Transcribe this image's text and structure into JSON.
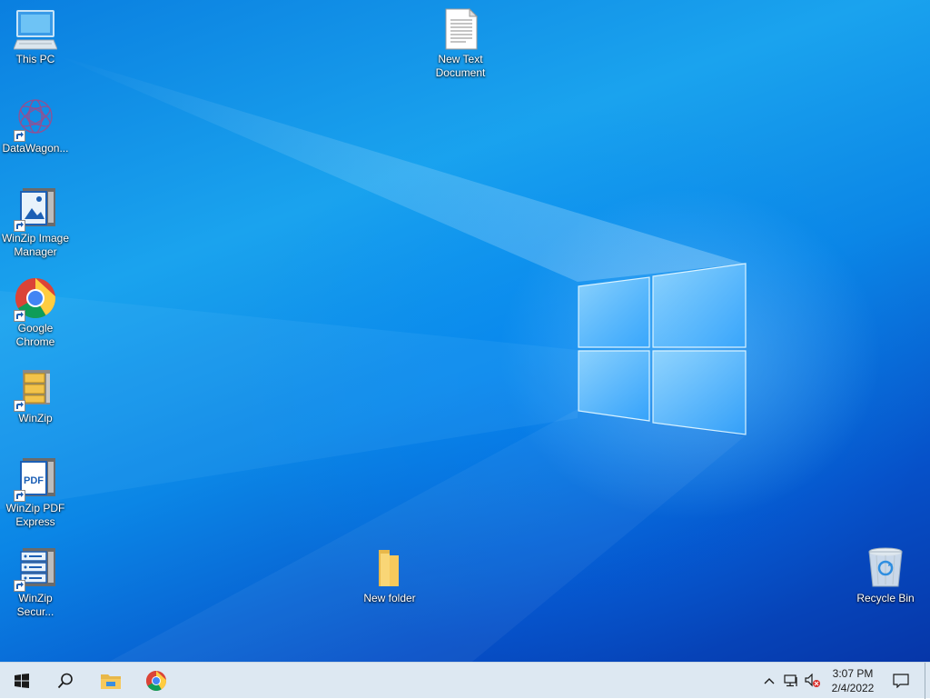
{
  "desktop": {
    "icons": {
      "this_pc": "This PC",
      "datawagon": "DataWagon...",
      "winzip_image_manager": "WinZip Image\nManager",
      "google_chrome": "Google\nChrome",
      "winzip": "WinZip",
      "winzip_pdf_express": "WinZip PDF\nExpress",
      "winzip_secure": "WinZip\nSecur...",
      "new_text_document": "New Text\nDocument",
      "new_folder": "New folder",
      "recycle_bin": "Recycle Bin"
    }
  },
  "taskbar": {
    "clock": {
      "time": "3:07 PM",
      "date": "2/4/2022"
    },
    "icons": [
      "windows-start-icon",
      "search-icon",
      "file-explorer-icon",
      "chrome-icon"
    ],
    "tray_icons": [
      "chevron-up-icon",
      "network-icon",
      "volume-muted-icon",
      "notification-icon"
    ]
  },
  "colors": {
    "accent": "#0b86e6",
    "taskbar": "#dde8f2"
  }
}
